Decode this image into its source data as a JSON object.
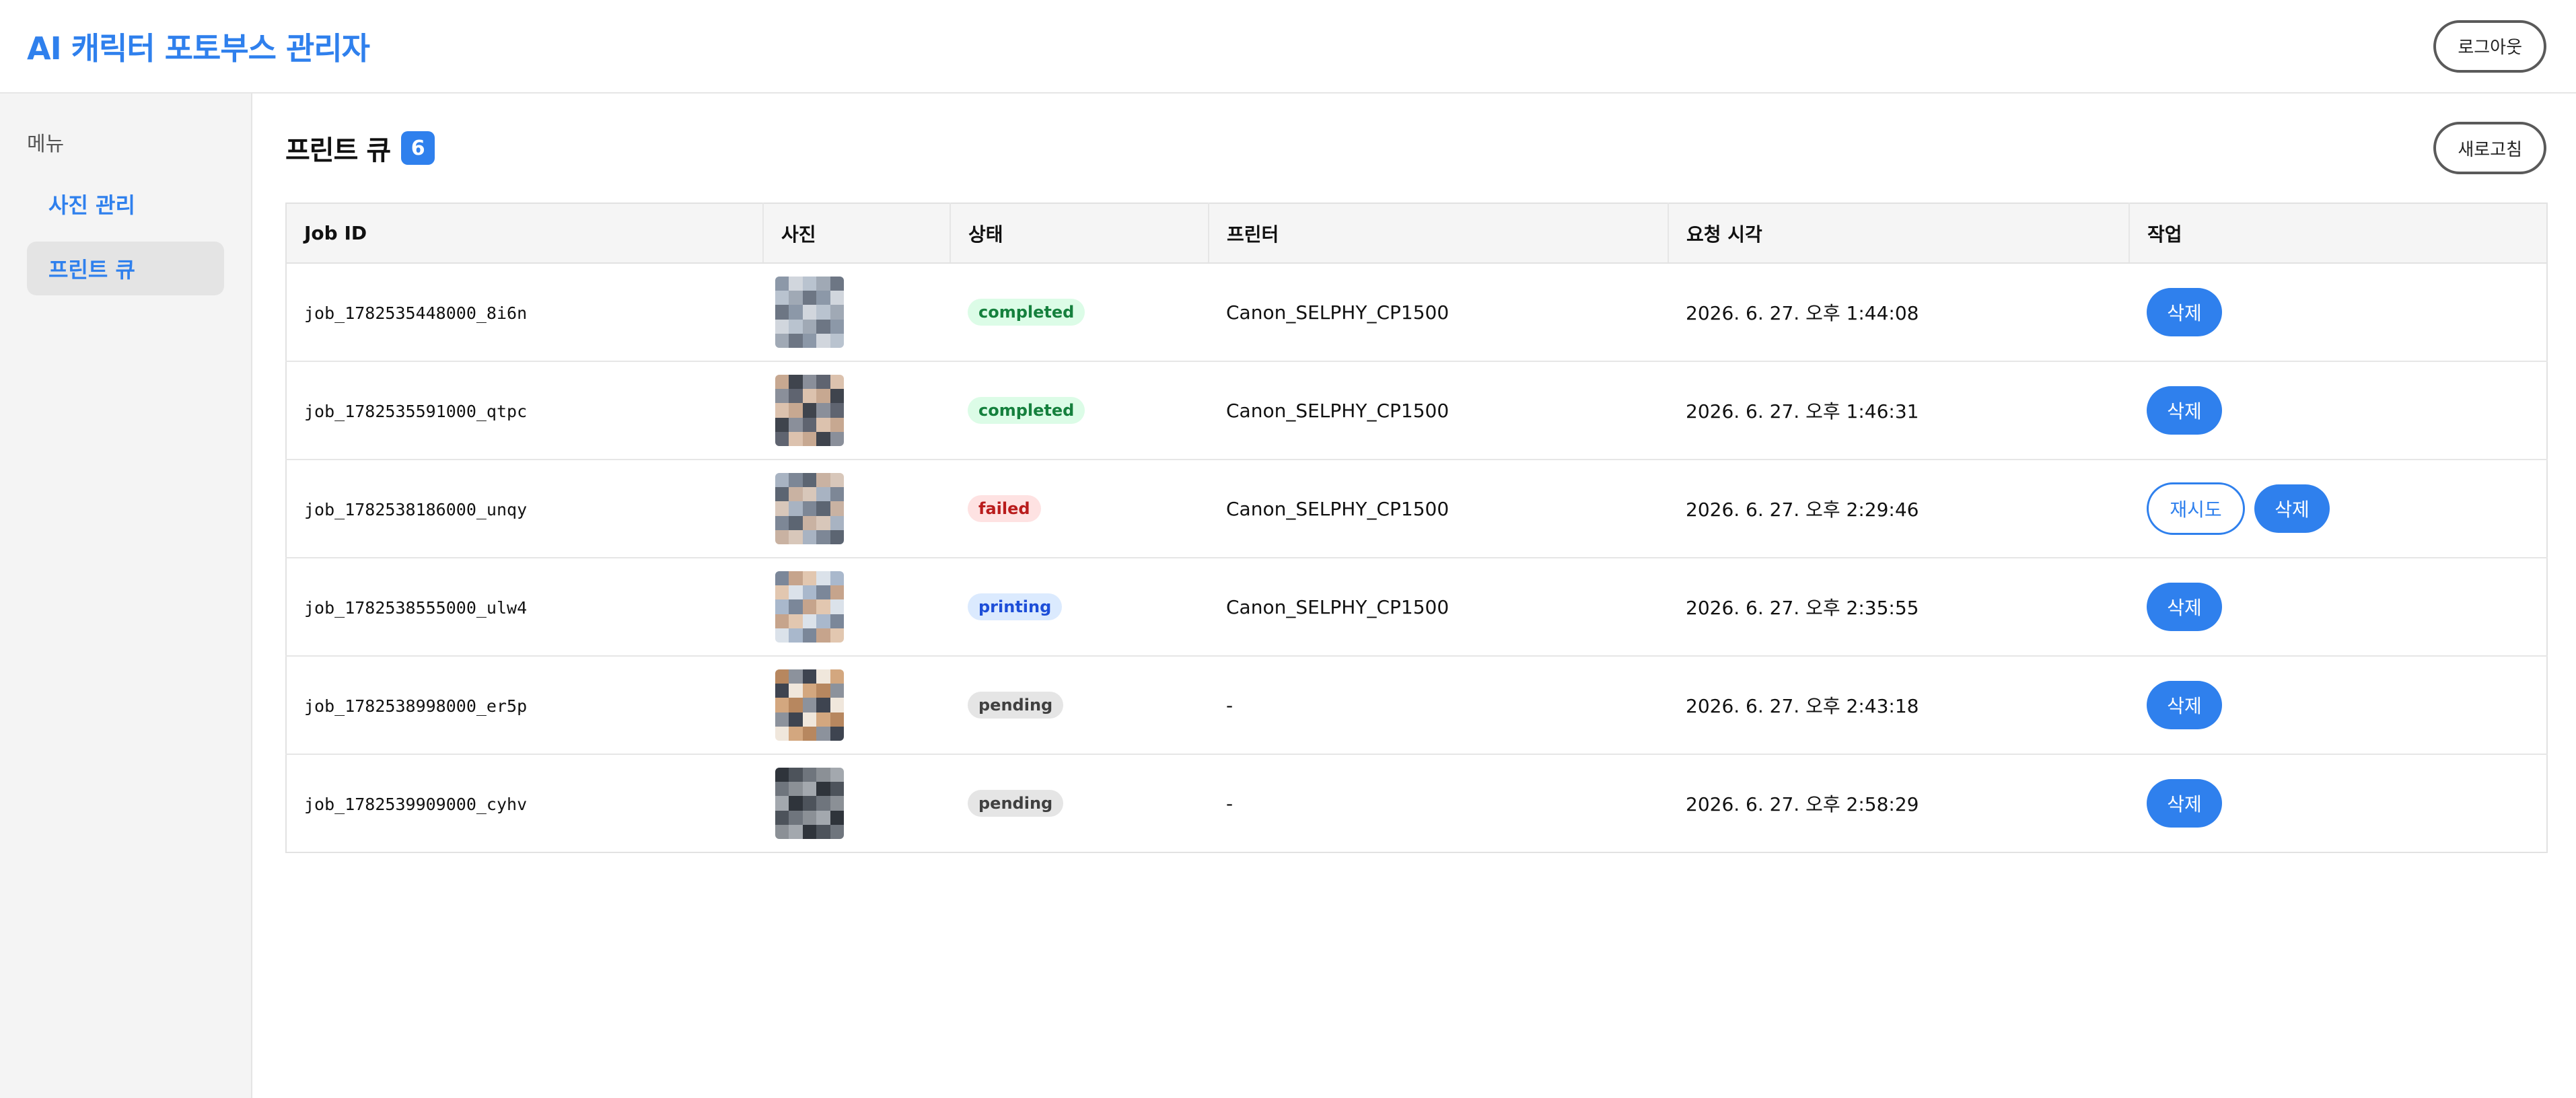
{
  "header": {
    "title": "AI 캐릭터 포토부스 관리자",
    "logout_label": "로그아웃"
  },
  "sidebar": {
    "heading": "메뉴",
    "items": [
      {
        "label": "사진 관리",
        "active": false
      },
      {
        "label": "프린트 큐",
        "active": true
      }
    ]
  },
  "main": {
    "title": "프린트 큐",
    "count": "6",
    "refresh_label": "새로고침",
    "columns": [
      "Job ID",
      "사진",
      "상태",
      "프린터",
      "요청 시각",
      "작업"
    ],
    "delete_label": "삭제",
    "retry_label": "재시도",
    "rows": [
      {
        "job_id": "job_1782535448000_8i6n",
        "status": "completed",
        "printer": "Canon_SELPHY_CP1500",
        "requested_at": "2026. 6. 27. 오후 1:44:08",
        "retry": false,
        "palette": [
          "#8c98a8",
          "#b9c3cf",
          "#6d7684",
          "#d1d6dd",
          "#a0a9b5"
        ]
      },
      {
        "job_id": "job_1782535591000_qtpc",
        "status": "completed",
        "printer": "Canon_SELPHY_CP1500",
        "requested_at": "2026. 6. 27. 오후 1:46:31",
        "retry": false,
        "palette": [
          "#5f6470",
          "#c7a891",
          "#8a8f9a",
          "#dcc2ae",
          "#3f444d"
        ]
      },
      {
        "job_id": "job_1782538186000_unqy",
        "status": "failed",
        "printer": "Canon_SELPHY_CP1500",
        "requested_at": "2026. 6. 27. 오후 2:29:46",
        "retry": true,
        "palette": [
          "#7d8796",
          "#c9b2a2",
          "#a8b3c2",
          "#5c6572",
          "#d8c7ba"
        ]
      },
      {
        "job_id": "job_1782538555000_ulw4",
        "status": "printing",
        "printer": "Canon_SELPHY_CP1500",
        "requested_at": "2026. 6. 27. 오후 2:35:55",
        "retry": false,
        "palette": [
          "#a9b8cc",
          "#c6a48c",
          "#dbe2ea",
          "#7b8799",
          "#e2c7b0"
        ]
      },
      {
        "job_id": "job_1782538998000_er5p",
        "status": "pending",
        "printer": "-",
        "requested_at": "2026. 6. 27. 오후 2:43:18",
        "retry": false,
        "palette": [
          "#3e4450",
          "#d3a77f",
          "#8c929c",
          "#f0e7dc",
          "#b7875f"
        ]
      },
      {
        "job_id": "job_1782539909000_cyhv",
        "status": "pending",
        "printer": "-",
        "requested_at": "2026. 6. 27. 오후 2:58:29",
        "retry": false,
        "palette": [
          "#2f343b",
          "#6f757d",
          "#a3a8ae",
          "#4d535b",
          "#8b9096"
        ]
      }
    ]
  },
  "status_colors": {
    "completed": {
      "bg": "#dcfce7",
      "fg": "#15803d"
    },
    "failed": {
      "bg": "#fee2e2",
      "fg": "#b91c1c"
    },
    "printing": {
      "bg": "#dbeafe",
      "fg": "#1d4ed8"
    },
    "pending": {
      "bg": "#e5e5e5",
      "fg": "#404040"
    }
  },
  "colors": {
    "accent": "#2f80ed"
  }
}
